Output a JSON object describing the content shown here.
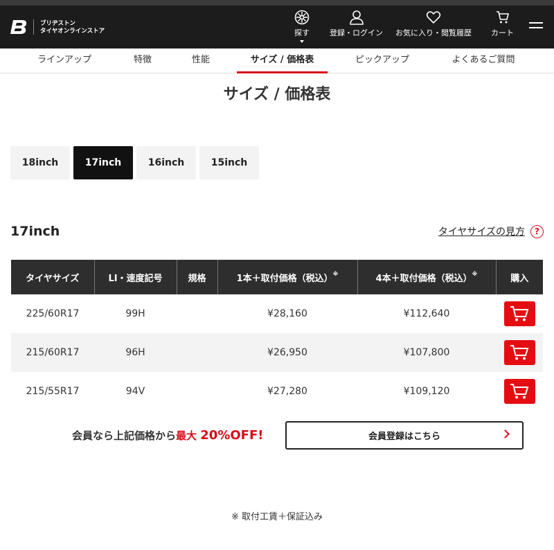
{
  "header": {
    "brand_line1": "ブリヂストン",
    "brand_line2": "タイヤオンラインストア",
    "nav": [
      {
        "label": "探す",
        "icon": "tire-icon"
      },
      {
        "label": "登録・ログイン",
        "icon": "user-icon"
      },
      {
        "label": "お気に入り・閲覧履歴",
        "icon": "heart-icon"
      },
      {
        "label": "カート",
        "icon": "cart-icon"
      }
    ]
  },
  "subnav": [
    "ラインアップ",
    "特徴",
    "性能",
    "サイズ / 価格表",
    "ピックアップ",
    "よくあるご質問"
  ],
  "page_title": "サイズ / 価格表",
  "size_tabs": [
    "18inch",
    "17inch",
    "16inch",
    "15inch"
  ],
  "active_tab": "17inch",
  "section_title": "17inch",
  "help_link": "タイヤサイズの見方",
  "help_icon": "?",
  "table": {
    "headers": [
      "タイヤサイズ",
      "LI・速度記号",
      "規格",
      "1本＋取付価格（税込）",
      "4本＋取付価格（税込）",
      "購入"
    ],
    "note_mark": "※",
    "rows": [
      {
        "size": "225/60R17",
        "li": "99H",
        "spec": "",
        "price1": "¥28,160",
        "price4": "¥112,640"
      },
      {
        "size": "215/60R17",
        "li": "96H",
        "spec": "",
        "price1": "¥26,950",
        "price4": "¥107,800"
      },
      {
        "size": "215/55R17",
        "li": "94V",
        "spec": "",
        "price1": "¥27,280",
        "price4": "¥109,120"
      }
    ]
  },
  "promo": {
    "text1": "会員なら上記価格から",
    "text2": "最大",
    "text3": "20%OFF!"
  },
  "member_button": "会員登録はこちら",
  "footnote": "※ 取付工賃＋保証込み",
  "colors": {
    "accent": "#d80c18",
    "cart_button": "#e40d12",
    "header_bg": "#1c1c1c"
  }
}
